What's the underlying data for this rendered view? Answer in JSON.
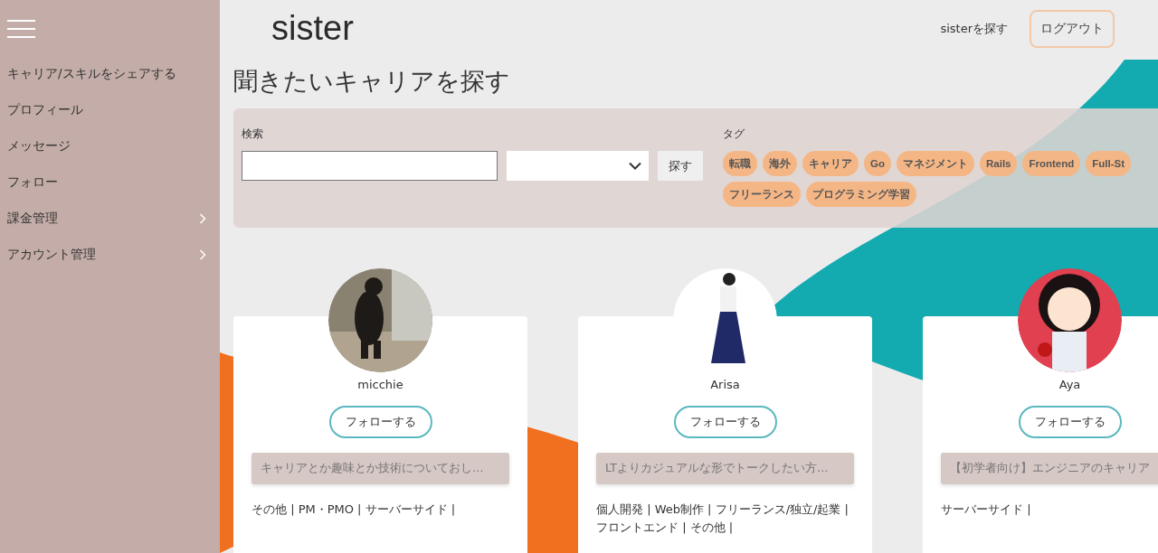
{
  "sidebar": {
    "items": [
      {
        "label": "キャリア/スキルをシェアする",
        "has_submenu": false
      },
      {
        "label": "プロフィール",
        "has_submenu": false
      },
      {
        "label": "メッセージ",
        "has_submenu": false
      },
      {
        "label": "フォロー",
        "has_submenu": false
      },
      {
        "label": "課金管理",
        "has_submenu": true
      },
      {
        "label": "アカウント管理",
        "has_submenu": true
      }
    ]
  },
  "header": {
    "logo": "sister",
    "nav_link": "sisterを探す",
    "logout_button": "ログアウト"
  },
  "page_title": "聞きたいキャリアを探す",
  "search": {
    "label": "検索",
    "button": "探す"
  },
  "tags": {
    "label": "タグ",
    "items": [
      "転職",
      "海外",
      "キャリア",
      "Go",
      "マネジメント",
      "Rails",
      "Frontend",
      "Full-St",
      "フリーランス",
      "プログラミング学習"
    ]
  },
  "cards": [
    {
      "name": "micchie",
      "follow_button": "フォローする",
      "intro": "キャリアとか趣味とか技術についておし…",
      "categories": "その他 | PM・PMO | サーバーサイド |"
    },
    {
      "name": "Arisa",
      "follow_button": "フォローする",
      "intro": "LTよりカジュアルな形でトークしたい方…",
      "categories": "個人開発 | Web制作 | フリーランス/独立/起業 | フロントエンド | その他 |"
    },
    {
      "name": "Aya",
      "follow_button": "フォローする",
      "intro": "【初学者向け】エンジニアのキャリア",
      "categories": "サーバーサイド |"
    }
  ]
}
